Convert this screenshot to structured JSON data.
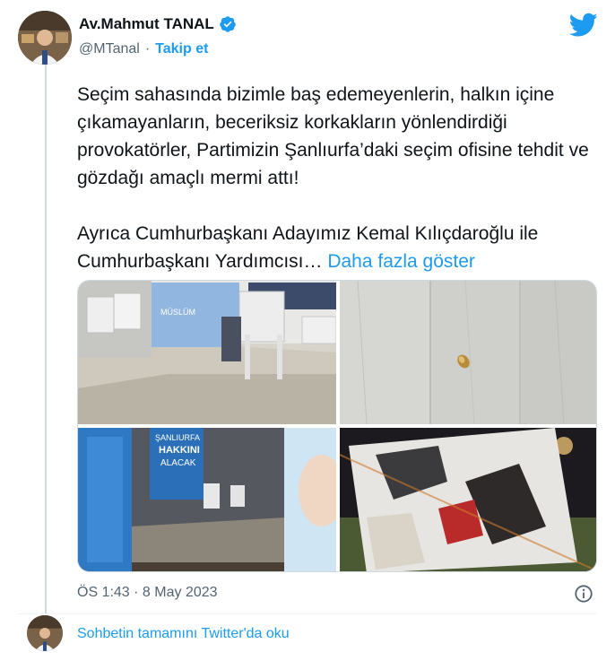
{
  "author": {
    "display_name": "Av.Mahmut TANAL",
    "handle": "@MTanal",
    "separator": "·",
    "follow_label": "Takip et"
  },
  "tweet": {
    "text": "Seçim sahasında bizimle baş edemeyenlerin, halkın içine çıkamayanların, beceriksiz korkakların yönlendirdiği provokatörler, Partimizin Şanlıurfa’daki seçim ofisine tehdit ve gözdağı amaçlı mermi attı!\n\nAyrıca Cumhurbaşkanı Adayımız Kemal Kılıçdaroğlu ile Cumhurbaşkanı Yardımcısı… ",
    "show_more_label": "Daha fazla göster",
    "timestamp": "ÖS 1:43 · 8 May 2023"
  },
  "photos": {
    "photo1_banner_text": "MÜSLÜM",
    "photo3_banner_line1": "ŞANLIURFA",
    "photo3_banner_line2": "HAKKINI",
    "photo3_banner_line3": "ALACAK"
  },
  "footer": {
    "read_thread_label": "Sohbetin tamamını Twitter'da oku"
  },
  "colors": {
    "accent": "#1d9bf0",
    "secondary_text": "#536471"
  },
  "icons": {
    "verified": "verified-badge-icon",
    "twitter": "twitter-bird-icon",
    "info": "info-icon"
  }
}
